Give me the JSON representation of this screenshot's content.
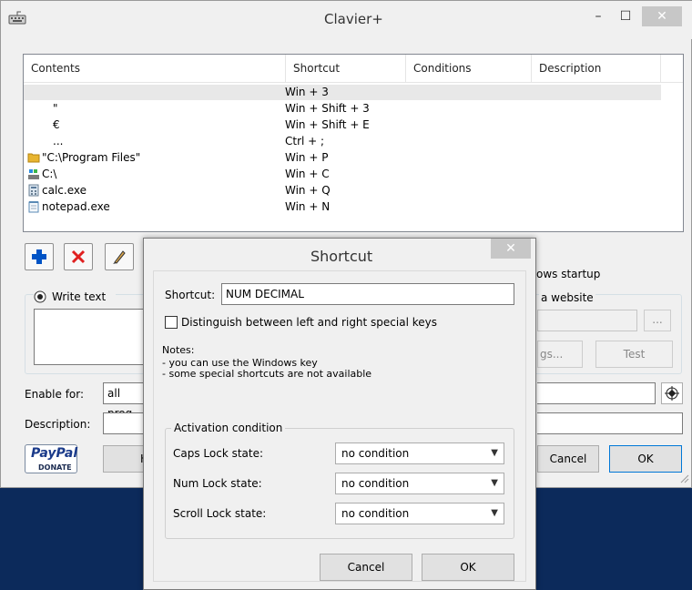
{
  "window": {
    "title": "Clavier+",
    "minimize_glyph": "–",
    "maximize_glyph": "☐",
    "close_glyph": "✕"
  },
  "list": {
    "columns": [
      "Contents",
      "Shortcut",
      "Conditions",
      "Description"
    ],
    "rows": [
      {
        "icon": "",
        "contents": "",
        "shortcut": "Win + 3",
        "selected": true
      },
      {
        "icon": "",
        "contents": "\"",
        "shortcut": "Win + Shift + 3"
      },
      {
        "icon": "",
        "contents": "€",
        "shortcut": "Win + Shift + E"
      },
      {
        "icon": "",
        "contents": "...",
        "shortcut": "Ctrl + ;"
      },
      {
        "icon": "folder-icon",
        "contents": "\"C:\\Program Files\"",
        "shortcut": "Win + P"
      },
      {
        "icon": "drive-icon",
        "contents": "C:\\",
        "shortcut": "Win + C"
      },
      {
        "icon": "calculator-icon",
        "contents": "calc.exe",
        "shortcut": "Win + Q"
      },
      {
        "icon": "notepad-icon",
        "contents": "notepad.exe",
        "shortcut": "Win + N"
      }
    ]
  },
  "toolbar": {
    "add_icon": "plus-icon",
    "delete_icon": "x-icon",
    "edit_icon": "pencil-icon"
  },
  "main": {
    "windows_startup_label": "ows startup",
    "write_text_label": "Write text",
    "website_label": "a website",
    "browse_label": "...",
    "settings_button": "gs...",
    "test_button": "Test",
    "enable_for_label": "Enable for:",
    "enable_for_value": "all prog",
    "description_label": "Description:",
    "paypal_label": "PayPal",
    "donate_label": "DONATE",
    "help_button": "H",
    "cancel_button": "Cancel",
    "ok_button": "OK"
  },
  "dialog": {
    "title": "Shortcut",
    "close_glyph": "✕",
    "shortcut_label": "Shortcut:",
    "shortcut_value": "NUM DECIMAL",
    "distinguish_label": "Distinguish between left and right special keys",
    "notes": [
      "Notes:",
      "- you can use the Windows key",
      "- some special shortcuts are not available"
    ],
    "activation_label": "Activation condition",
    "conditions": [
      {
        "label": "Caps Lock state:",
        "value": "no condition"
      },
      {
        "label": "Num Lock state:",
        "value": "no condition"
      },
      {
        "label": "Scroll Lock state:",
        "value": "no condition"
      }
    ],
    "cancel_button": "Cancel",
    "ok_button": "OK"
  },
  "colors": {
    "accent": "#0c2a5b",
    "selected_row": "#e8e8e8",
    "add": "#0053c5",
    "delete": "#e02020"
  }
}
